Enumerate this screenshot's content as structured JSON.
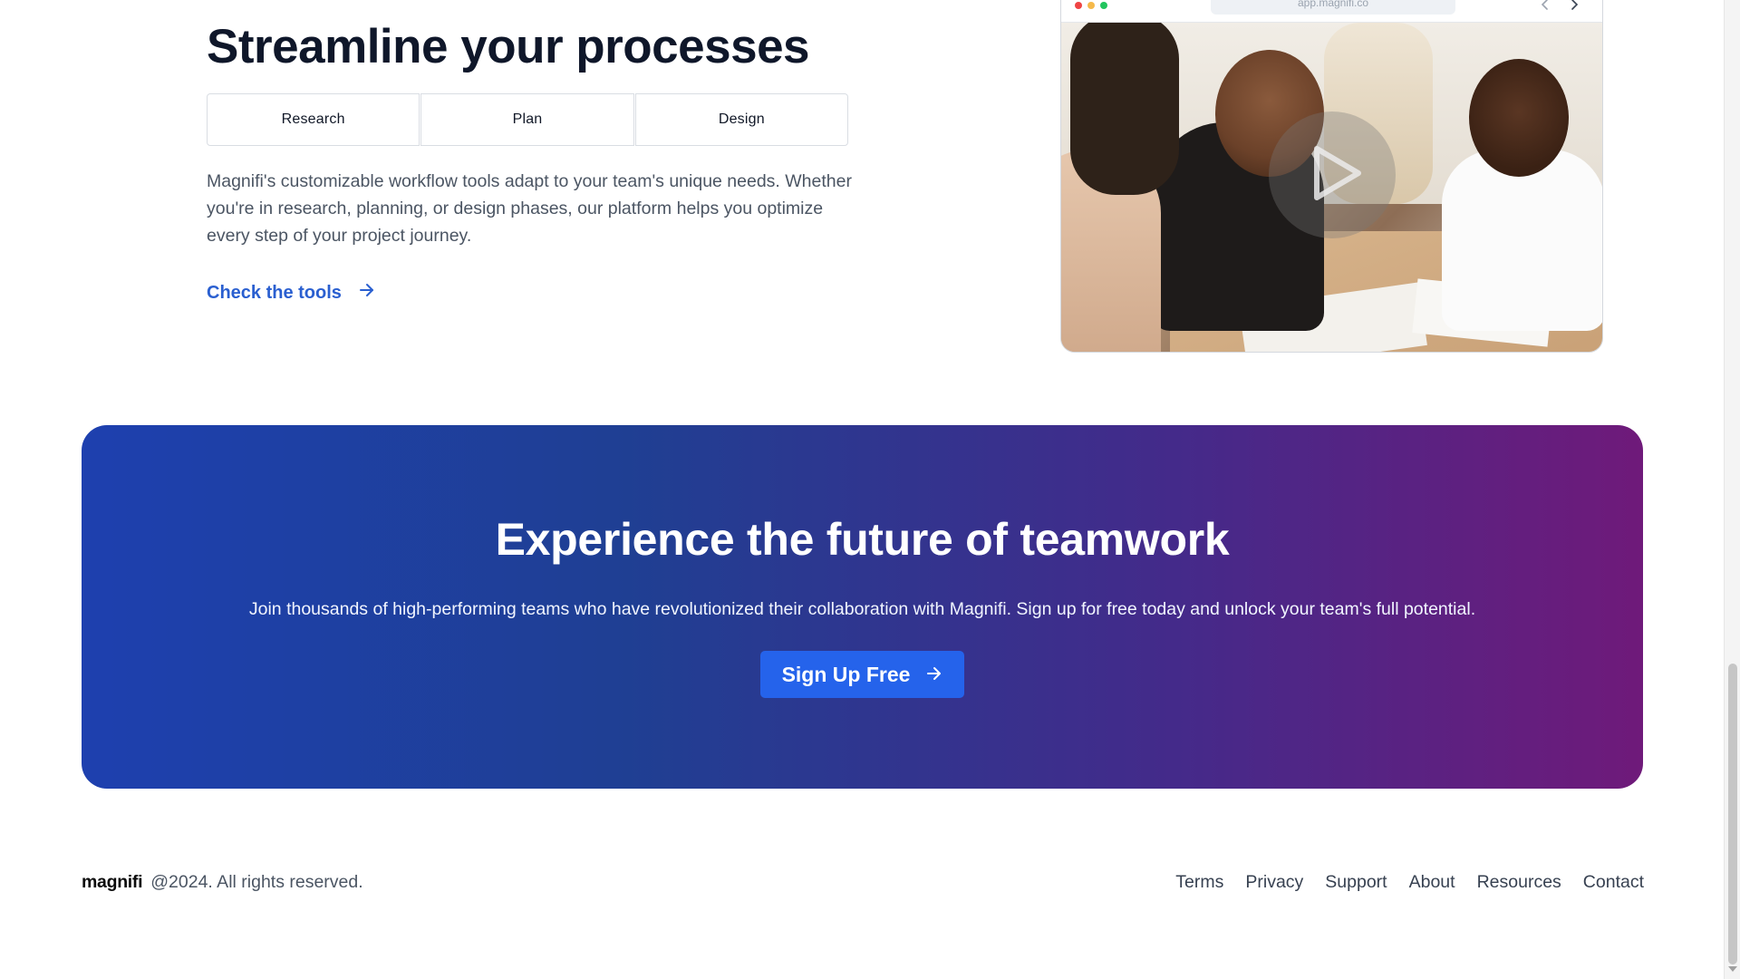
{
  "feature": {
    "title": "Streamline your processes",
    "tabs": [
      {
        "label": "Research"
      },
      {
        "label": "Plan"
      },
      {
        "label": "Design"
      }
    ],
    "description": "Magnifi's customizable workflow tools adapt to your team's unique needs. Whether you're in research, planning, or design phases, our platform helps you optimize every step of your project journey.",
    "link_label": "Check the tools",
    "link_icon": "arrow-right-icon"
  },
  "browser_mockup": {
    "url": "app.magnifi.co",
    "window_controls": [
      "red",
      "yellow",
      "green"
    ],
    "nav_icons": [
      "chevron-left-icon",
      "chevron-right-icon"
    ],
    "media_icon": "play-icon"
  },
  "cta": {
    "title": "Experience the future of teamwork",
    "subtitle": "Join thousands of high-performing teams who have revolutionized their collaboration with Magnifi. Sign up for free today and unlock your team's full potential.",
    "button_label": "Sign Up Free",
    "button_icon": "arrow-right-icon",
    "colors": {
      "gradient_start": "#1e40af",
      "gradient_end": "#6f1a7a",
      "button": "#2563eb"
    }
  },
  "footer": {
    "brand": "magnifi",
    "copyright": "@2024. All rights reserved.",
    "links": [
      {
        "label": "Terms"
      },
      {
        "label": "Privacy"
      },
      {
        "label": "Support"
      },
      {
        "label": "About"
      },
      {
        "label": "Resources"
      },
      {
        "label": "Contact"
      }
    ]
  },
  "colors": {
    "link": "#2a5fd0",
    "heading": "#0f172a",
    "body_text": "#4b5563"
  }
}
